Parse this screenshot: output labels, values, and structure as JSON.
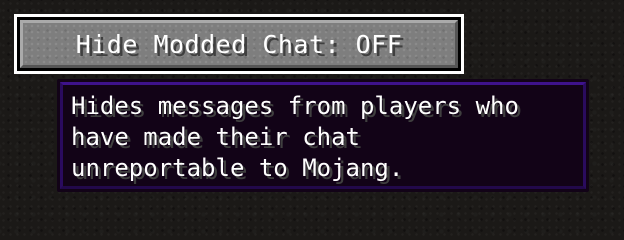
{
  "button": {
    "label": "Hide Modded Chat: OFF"
  },
  "tooltip": {
    "lines": [
      "Hides messages from players who",
      "have made their chat",
      "unreportable to Mojang."
    ]
  },
  "colors": {
    "button_face": "#7e7e7e",
    "button_focus_border": "#ffffff",
    "tooltip_background": "#120317",
    "tooltip_border": "#2a0b5e",
    "text": "#ffffff"
  }
}
